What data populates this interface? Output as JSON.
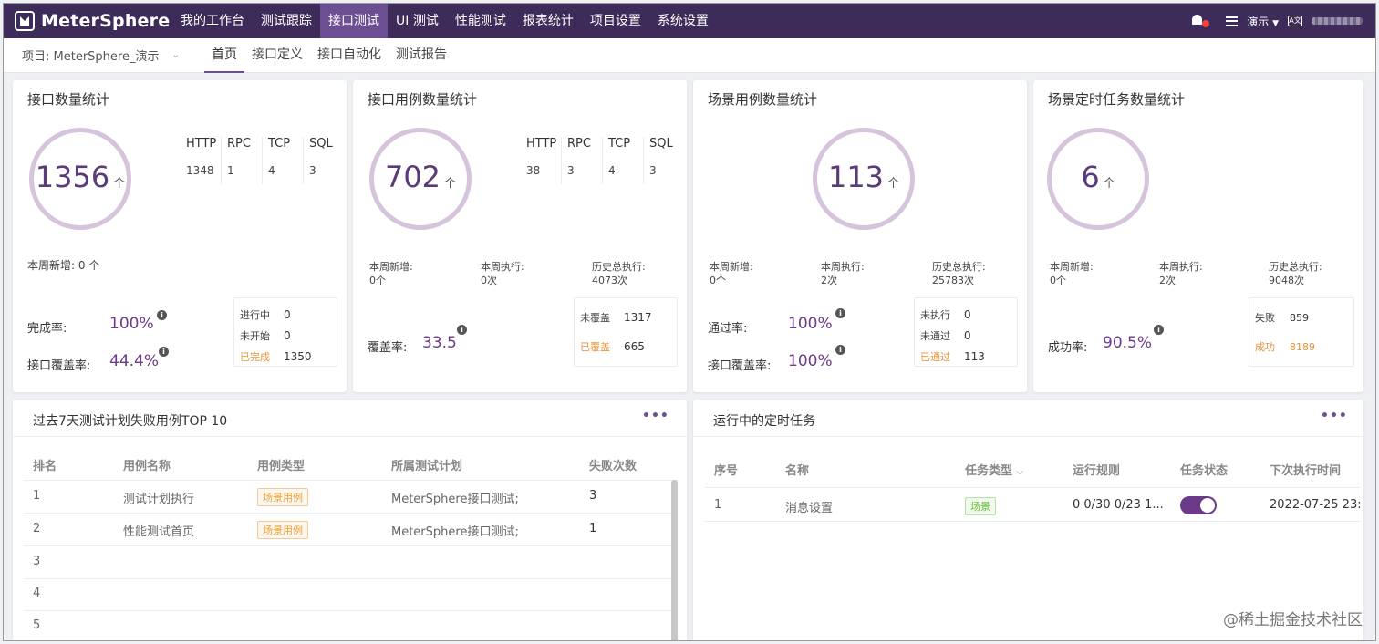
{
  "app": {
    "name": "MeterSphere"
  },
  "topnav": {
    "items": [
      "我的工作台",
      "测试跟踪",
      "接口测试",
      "UI 测试",
      "性能测试",
      "报表统计",
      "项目设置",
      "系统设置"
    ],
    "active_index": 2,
    "workspace": "演示",
    "lang_icon": "A文"
  },
  "subnav": {
    "project_label": "项目: MeterSphere_演示",
    "tabs": [
      "首页",
      "接口定义",
      "接口自动化",
      "测试报告"
    ],
    "active_index": 0
  },
  "cards": {
    "api": {
      "title": "接口数量统计",
      "count": "1356",
      "unit": "个",
      "types": {
        "headers": [
          "HTTP",
          "RPC",
          "TCP",
          "SQL"
        ],
        "values": [
          "1348",
          "1",
          "4",
          "3"
        ]
      },
      "week_new": "本周新增: 0 个",
      "completion_label": "完成率:",
      "completion_value": "100%",
      "coverage_label": "接口覆盖率:",
      "coverage_value": "44.4%",
      "status": [
        {
          "k": "进行中",
          "v": "0"
        },
        {
          "k": "未开始",
          "v": "0"
        },
        {
          "k": "已完成",
          "v": "1350"
        }
      ]
    },
    "case": {
      "title": "接口用例数量统计",
      "count": "702",
      "unit": "个",
      "types": {
        "headers": [
          "HTTP",
          "RPC",
          "TCP",
          "SQL"
        ],
        "values": [
          "38",
          "3",
          "4",
          "3"
        ]
      },
      "metrics": [
        {
          "k": "本周新增:",
          "v": "0个"
        },
        {
          "k": "本周执行:",
          "v": "0次"
        },
        {
          "k": "历史总执行:",
          "v": "4073次"
        }
      ],
      "coverage_label": "覆盖率:",
      "coverage_value": "33.5",
      "status": [
        {
          "k": "未覆盖",
          "v": "1317"
        },
        {
          "k": "已覆盖",
          "v": "665"
        }
      ]
    },
    "scenario": {
      "title": "场景用例数量统计",
      "count": "113",
      "unit": "个",
      "metrics": [
        {
          "k": "本周新增:",
          "v": "0个"
        },
        {
          "k": "本周执行:",
          "v": "2次"
        },
        {
          "k": "历史总执行:",
          "v": "25783次"
        }
      ],
      "pass_label": "通过率:",
      "pass_value": "100%",
      "coverage_label": "接口覆盖率:",
      "coverage_value": "100%",
      "status": [
        {
          "k": "未执行",
          "v": "0"
        },
        {
          "k": "未通过",
          "v": "0"
        },
        {
          "k": "已通过",
          "v": "113"
        }
      ]
    },
    "schedule": {
      "title": "场景定时任务数量统计",
      "count": "6",
      "unit": "个",
      "metrics": [
        {
          "k": "本周新增:",
          "v": "0个"
        },
        {
          "k": "本周执行:",
          "v": "2次"
        },
        {
          "k": "历史总执行:",
          "v": "9048次"
        }
      ],
      "success_label": "成功率:",
      "success_value": "90.5%",
      "status": [
        {
          "k": "失败",
          "v": "859"
        },
        {
          "k": "成功",
          "v": "8189"
        }
      ]
    }
  },
  "fail_table": {
    "title": "过去7天测试计划失败用例TOP 10",
    "more": "•••",
    "headers": [
      "排名",
      "用例名称",
      "用例类型",
      "所属测试计划",
      "失败次数"
    ],
    "rows": [
      {
        "rank": "1",
        "name": "测试计划执行",
        "type": "场景用例",
        "plan": "MeterSphere接口测试;",
        "count": "3"
      },
      {
        "rank": "2",
        "name": "性能测试首页",
        "type": "场景用例",
        "plan": "MeterSphere接口测试;",
        "count": "1"
      },
      {
        "rank": "3"
      },
      {
        "rank": "4"
      },
      {
        "rank": "5"
      }
    ]
  },
  "task_table": {
    "title": "运行中的定时任务",
    "more": "•••",
    "headers": [
      "序号",
      "名称",
      "任务类型",
      "运行规则",
      "任务状态",
      "下次执行时间"
    ],
    "sort_icon": "⌵",
    "rows": [
      {
        "no": "1",
        "name": "消息设置",
        "type": "场景",
        "rule": "0 0/30 0/23 1...",
        "enabled": true,
        "next": "2022-07-25 23:"
      }
    ]
  },
  "watermark": "@稀土掘金技术社区",
  "colors": {
    "nav_bg": "#3d2b59",
    "accent": "#6b3a88",
    "ring": "#d6c3dc",
    "orange": "#e8923a"
  }
}
